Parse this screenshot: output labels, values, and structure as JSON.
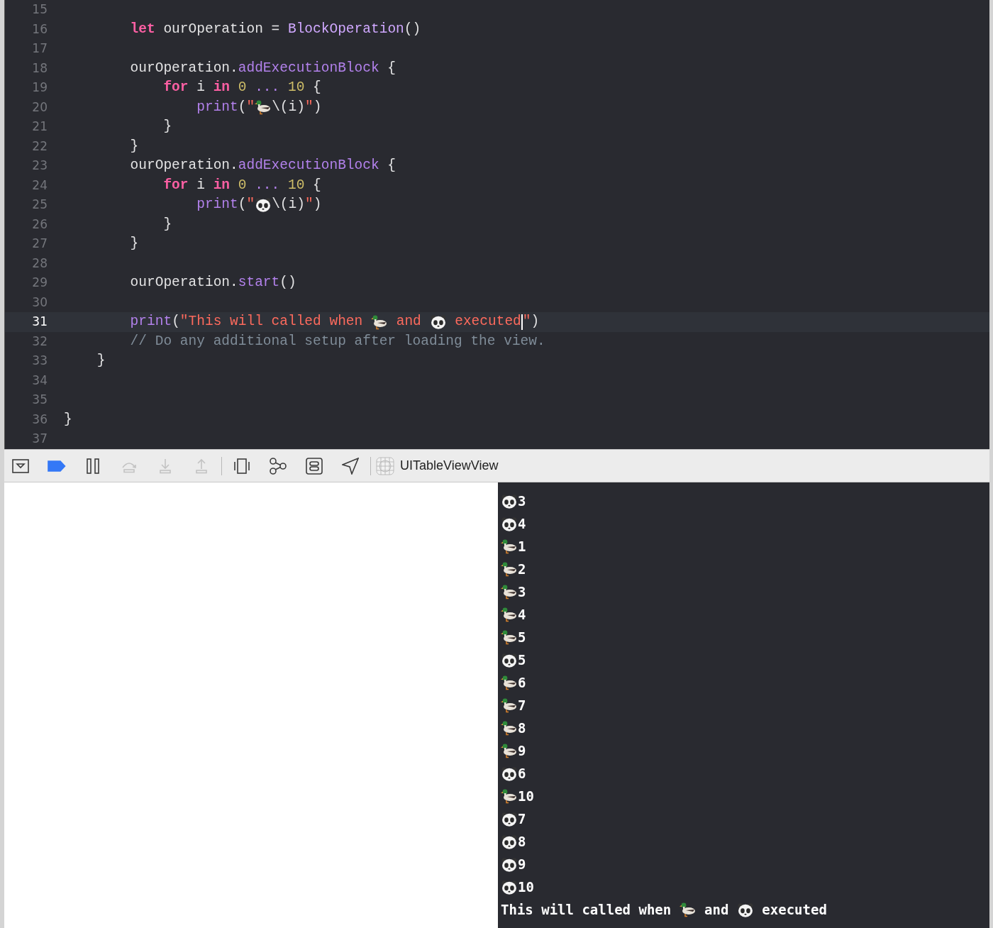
{
  "editor": {
    "lines": [
      {
        "children": [
          {
            "children": [
              {
                "number": "15",
                "selected": false
              },
              {
                "number": "16",
                "selected": false,
                "tokens": [
                  {
                    "kind": "keyword",
                    "t": "let"
                  },
                  {
                    "kind": "plain",
                    "t": " ourOperation = "
                  },
                  {
                    "kind": "type",
                    "t": "BlockOperation"
                  },
                  {
                    "kind": "plain",
                    "t": "()"
                  }
                ]
              },
              {
                "number": "17",
                "selected": false
              },
              {
                "number": "18",
                "selected": false,
                "tokens": [
                  {
                    "kind": "plain",
                    "t": "ourOperation."
                  },
                  {
                    "kind": "function",
                    "t": "addExecutionBlock"
                  },
                  {
                    "kind": "plain",
                    "t": " {"
                  }
                ]
              },
              {
                "children": [
                  {
                    "number": "19",
                    "selected": false,
                    "tokens": [
                      {
                        "kind": "keyword",
                        "t": "for"
                      },
                      {
                        "kind": "plain",
                        "t": " i "
                      },
                      {
                        "kind": "keyword",
                        "t": "in"
                      },
                      {
                        "kind": "number",
                        "t": " 0"
                      },
                      {
                        "kind": "function",
                        "t": " ... "
                      },
                      {
                        "kind": "number",
                        "t": "10"
                      },
                      {
                        "kind": "plain",
                        "t": " {"
                      }
                    ]
                  },
                  {
                    "children": [
                      {
                        "number": "20",
                        "selected": false,
                        "tokens": [
                          {
                            "kind": "function",
                            "t": "print"
                          },
                          {
                            "kind": "plain",
                            "t": "("
                          },
                          {
                            "kind": "string",
                            "t": "\""
                          },
                          {
                            "kind": "duck"
                          },
                          {
                            "kind": "plain",
                            "t": "\\(i)"
                          },
                          {
                            "kind": "string",
                            "t": "\""
                          },
                          {
                            "kind": "plain",
                            "t": ")"
                          }
                        ]
                      }
                    ]
                  },
                  {
                    "number": "21",
                    "selected": false,
                    "tokens": [
                      {
                        "kind": "plain",
                        "t": "}"
                      }
                    ]
                  }
                ]
              },
              {
                "number": "22",
                "selected": false,
                "tokens": [
                  {
                    "kind": "plain",
                    "t": "}"
                  }
                ]
              },
              {
                "number": "23",
                "selected": false,
                "tokens": [
                  {
                    "kind": "plain",
                    "t": "ourOperation."
                  },
                  {
                    "kind": "function",
                    "t": "addExecutionBlock"
                  },
                  {
                    "kind": "plain",
                    "t": " {"
                  }
                ]
              },
              {
                "children": [
                  {
                    "number": "24",
                    "selected": false,
                    "tokens": [
                      {
                        "kind": "keyword",
                        "t": "for"
                      },
                      {
                        "kind": "plain",
                        "t": " i "
                      },
                      {
                        "kind": "keyword",
                        "t": "in"
                      },
                      {
                        "kind": "number",
                        "t": " 0"
                      },
                      {
                        "kind": "function",
                        "t": " ... "
                      },
                      {
                        "kind": "number",
                        "t": "10"
                      },
                      {
                        "kind": "plain",
                        "t": " {"
                      }
                    ]
                  },
                  {
                    "children": [
                      {
                        "number": "25",
                        "selected": false,
                        "tokens": [
                          {
                            "kind": "function",
                            "t": "print"
                          },
                          {
                            "kind": "plain",
                            "t": "("
                          },
                          {
                            "kind": "string",
                            "t": "\""
                          },
                          {
                            "kind": "panda"
                          },
                          {
                            "kind": "plain",
                            "t": "\\(i)"
                          },
                          {
                            "kind": "string",
                            "t": "\""
                          },
                          {
                            "kind": "plain",
                            "t": ")"
                          }
                        ]
                      }
                    ]
                  },
                  {
                    "number": "26",
                    "selected": false,
                    "tokens": [
                      {
                        "kind": "plain",
                        "t": "}"
                      }
                    ]
                  }
                ]
              },
              {
                "number": "27",
                "selected": false,
                "tokens": [
                  {
                    "kind": "plain",
                    "t": "}"
                  }
                ]
              },
              {
                "number": "28",
                "selected": false
              },
              {
                "number": "29",
                "selected": false,
                "tokens": [
                  {
                    "kind": "plain",
                    "t": "ourOperation."
                  },
                  {
                    "kind": "function",
                    "t": "start"
                  },
                  {
                    "kind": "plain",
                    "t": "()"
                  }
                ]
              },
              {
                "number": "30",
                "selected": false
              },
              {
                "number": "31",
                "selected": true,
                "tokens": [
                  {
                    "kind": "function",
                    "t": "print"
                  },
                  {
                    "kind": "plain",
                    "t": "("
                  },
                  {
                    "kind": "string",
                    "t": "\"This will called when "
                  },
                  {
                    "kind": "duck"
                  },
                  {
                    "kind": "string",
                    "t": " and "
                  },
                  {
                    "kind": "panda"
                  },
                  {
                    "kind": "string",
                    "t": " executed"
                  },
                  {
                    "kind": "cursor"
                  },
                  {
                    "kind": "string",
                    "t": "\""
                  },
                  {
                    "kind": "plain",
                    "t": ")"
                  }
                ]
              },
              {
                "number": "32",
                "selected": false,
                "tokens": [
                  {
                    "kind": "comment",
                    "t": "// Do any additional setup after loading the view."
                  }
                ]
              }
            ]
          },
          {
            "number": "33",
            "selected": false,
            "tokens": [
              {
                "kind": "plain",
                "t": "}"
              }
            ]
          }
        ]
      },
      {
        "number": "34",
        "selected": false
      },
      {
        "number": "35",
        "selected": false
      },
      {
        "number": "36",
        "selected": false,
        "tokens": [
          {
            "kind": "plain",
            "t": "}"
          }
        ]
      },
      {
        "number": "37",
        "selected": false
      }
    ]
  },
  "debug_bar": {
    "buttons": [
      {
        "kind": "hide",
        "disabled": false
      },
      {
        "kind": "breakpoints",
        "disabled": false
      },
      {
        "kind": "pause",
        "disabled": false
      },
      {
        "kind": "step-over",
        "disabled": true
      },
      {
        "kind": "step-into",
        "disabled": true
      },
      {
        "kind": "step-out",
        "disabled": true
      },
      {
        "kind": "view-hierarchy",
        "disabled": false
      },
      {
        "kind": "memory-graph",
        "disabled": false
      },
      {
        "kind": "environment",
        "disabled": false
      },
      {
        "kind": "location",
        "disabled": false
      }
    ],
    "target": {
      "label": "UITableViewView"
    }
  },
  "console": {
    "lines": [
      {
        "tokens": [
          {
            "kind": "panda"
          },
          {
            "kind": "text",
            "t": "3"
          }
        ]
      },
      {
        "tokens": [
          {
            "kind": "panda"
          },
          {
            "kind": "text",
            "t": "4"
          }
        ]
      },
      {
        "tokens": [
          {
            "kind": "duck"
          },
          {
            "kind": "text",
            "t": "1"
          }
        ]
      },
      {
        "tokens": [
          {
            "kind": "duck"
          },
          {
            "kind": "text",
            "t": "2"
          }
        ]
      },
      {
        "tokens": [
          {
            "kind": "duck"
          },
          {
            "kind": "text",
            "t": "3"
          }
        ]
      },
      {
        "tokens": [
          {
            "kind": "duck"
          },
          {
            "kind": "text",
            "t": "4"
          }
        ]
      },
      {
        "tokens": [
          {
            "kind": "duck"
          },
          {
            "kind": "text",
            "t": "5"
          }
        ]
      },
      {
        "tokens": [
          {
            "kind": "panda"
          },
          {
            "kind": "text",
            "t": "5"
          }
        ]
      },
      {
        "tokens": [
          {
            "kind": "duck"
          },
          {
            "kind": "text",
            "t": "6"
          }
        ]
      },
      {
        "tokens": [
          {
            "kind": "duck"
          },
          {
            "kind": "text",
            "t": "7"
          }
        ]
      },
      {
        "tokens": [
          {
            "kind": "duck"
          },
          {
            "kind": "text",
            "t": "8"
          }
        ]
      },
      {
        "tokens": [
          {
            "kind": "duck"
          },
          {
            "kind": "text",
            "t": "9"
          }
        ]
      },
      {
        "tokens": [
          {
            "kind": "panda"
          },
          {
            "kind": "text",
            "t": "6"
          }
        ]
      },
      {
        "tokens": [
          {
            "kind": "duck"
          },
          {
            "kind": "text",
            "t": "10"
          }
        ]
      },
      {
        "tokens": [
          {
            "kind": "panda"
          },
          {
            "kind": "text",
            "t": "7"
          }
        ]
      },
      {
        "tokens": [
          {
            "kind": "panda"
          },
          {
            "kind": "text",
            "t": "8"
          }
        ]
      },
      {
        "tokens": [
          {
            "kind": "panda"
          },
          {
            "kind": "text",
            "t": "9"
          }
        ]
      },
      {
        "tokens": [
          {
            "kind": "panda"
          },
          {
            "kind": "text",
            "t": "10"
          }
        ]
      },
      {
        "tokens": [
          {
            "kind": "text",
            "t": "This will called when "
          },
          {
            "kind": "duck"
          },
          {
            "kind": "text",
            "t": " and "
          },
          {
            "kind": "panda"
          },
          {
            "kind": "text",
            "t": " executed"
          }
        ]
      }
    ]
  }
}
